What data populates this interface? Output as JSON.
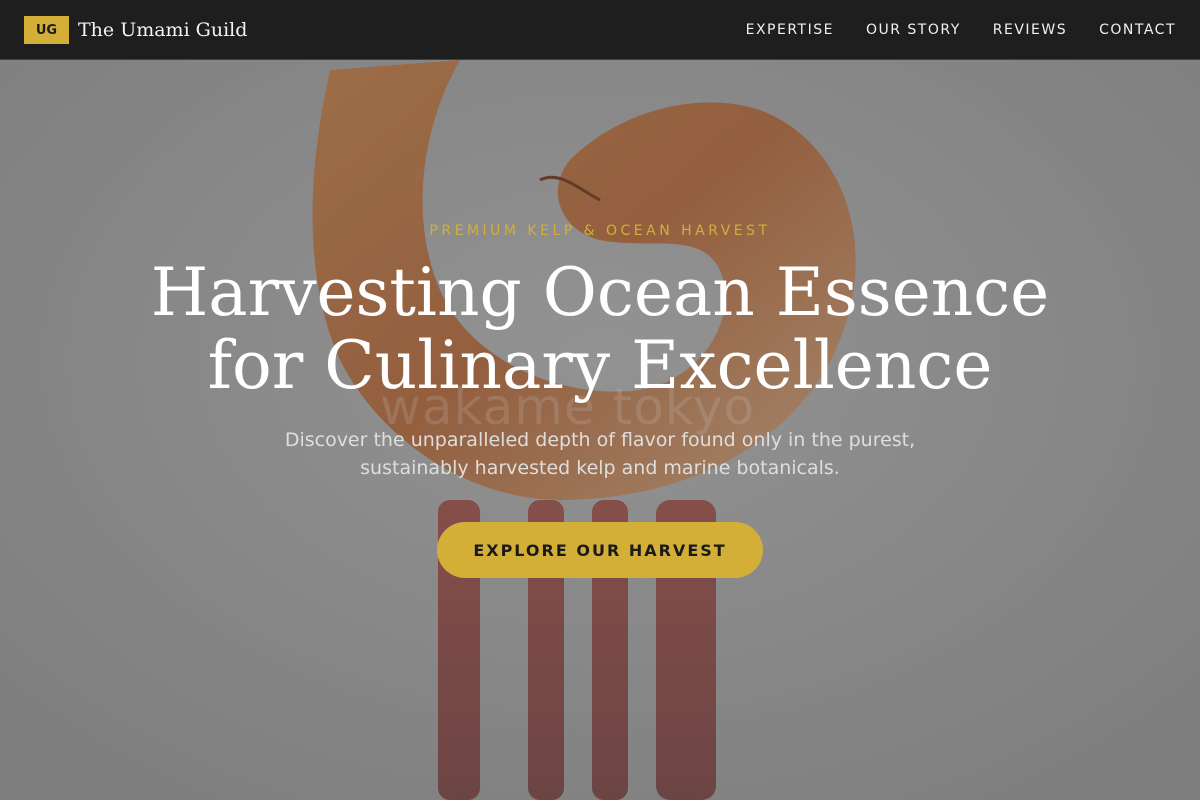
{
  "brand": {
    "badge": "UG",
    "name": "The Umami Guild",
    "accent_color": "#d4af37"
  },
  "nav": {
    "links": [
      {
        "label": "EXPERTISE"
      },
      {
        "label": "OUR STORY"
      },
      {
        "label": "REVIEWS"
      },
      {
        "label": "CONTACT"
      }
    ]
  },
  "hero": {
    "eyebrow": "PREMIUM KELP & OCEAN HARVEST",
    "headline_line1": "Harvesting Ocean Essence",
    "headline_line2": "for Culinary Excellence",
    "subheadline": "Discover the unparalleled depth of flavor found only in the purest, sustainably harvested kelp and marine botanicals.",
    "cta_label": "EXPLORE OUR HARVEST",
    "image_watermark": "wakame tokyo"
  }
}
